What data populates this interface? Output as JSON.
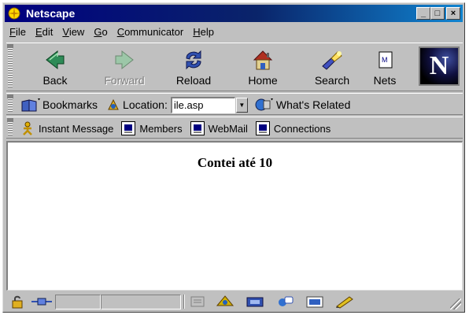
{
  "window": {
    "title": "Netscape"
  },
  "title_buttons": {
    "minimize": "_",
    "maximize": "□",
    "close": "×"
  },
  "menu": [
    {
      "label": "File",
      "key": "F",
      "rest": "ile"
    },
    {
      "label": "Edit",
      "key": "E",
      "rest": "dit"
    },
    {
      "label": "View",
      "key": "V",
      "rest": "iew"
    },
    {
      "label": "Go",
      "key": "G",
      "rest": "o"
    },
    {
      "label": "Communicator",
      "key": "C",
      "rest": "ommunicator"
    },
    {
      "label": "Help",
      "key": "H",
      "rest": "elp"
    }
  ],
  "navigation": {
    "back": "Back",
    "forward": "Forward",
    "reload": "Reload",
    "home": "Home",
    "search": "Search",
    "netscape": "Nets"
  },
  "logo": {
    "letter": "N"
  },
  "location_bar": {
    "bookmarks": "Bookmarks",
    "location_label": "Location:",
    "location_value": "ile.asp",
    "whats_related": "What's Related"
  },
  "personal_toolbar": {
    "instant_message": "Instant Message",
    "members": "Members",
    "webmail": "WebMail",
    "connections": "Connections"
  },
  "page": {
    "heading": "Contei até 10"
  },
  "colors": {
    "titlebar": "#000080",
    "chrome": "#c0c0c0",
    "content_bg": "#ffffff"
  }
}
